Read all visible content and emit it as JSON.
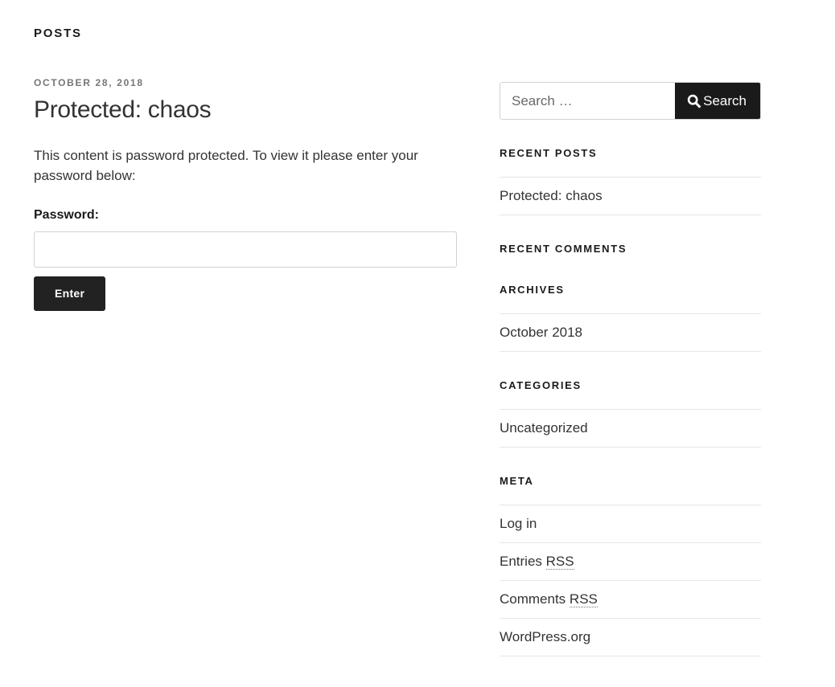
{
  "main": {
    "page_title": "POSTS",
    "post": {
      "date": "OCTOBER 28, 2018",
      "title": "Protected: chaos",
      "intro": "This content is password protected. To view it please enter your password below:",
      "password_label": "Password:",
      "password_value": "",
      "password_placeholder": "",
      "submit_label": "Enter"
    }
  },
  "sidebar": {
    "search": {
      "value": "",
      "placeholder": "Search …",
      "button_label": "Search",
      "icon": "search-icon"
    },
    "widgets": [
      {
        "title": "RECENT POSTS",
        "items": [
          "Protected: chaos"
        ]
      },
      {
        "title": "RECENT COMMENTS",
        "items": []
      },
      {
        "title": "ARCHIVES",
        "items": [
          "October 2018"
        ]
      },
      {
        "title": "CATEGORIES",
        "items": [
          "Uncategorized"
        ]
      },
      {
        "title": "META",
        "items": [
          "Log in",
          "Entries RSS",
          "Comments RSS",
          "WordPress.org"
        ]
      }
    ],
    "meta_labels": {
      "log_in": "Log in",
      "entries_prefix": "Entries ",
      "comments_prefix": "Comments ",
      "rss_abbr": "RSS",
      "wordpress_org": "WordPress.org"
    }
  },
  "colors": {
    "text": "#333333",
    "heading": "#1a1a1a",
    "muted": "#767676",
    "border": "#e6e6e6",
    "input_border": "#d1d1d1",
    "button_dark": "#1a1a1a",
    "submit_dark": "#222222",
    "background": "#ffffff"
  }
}
